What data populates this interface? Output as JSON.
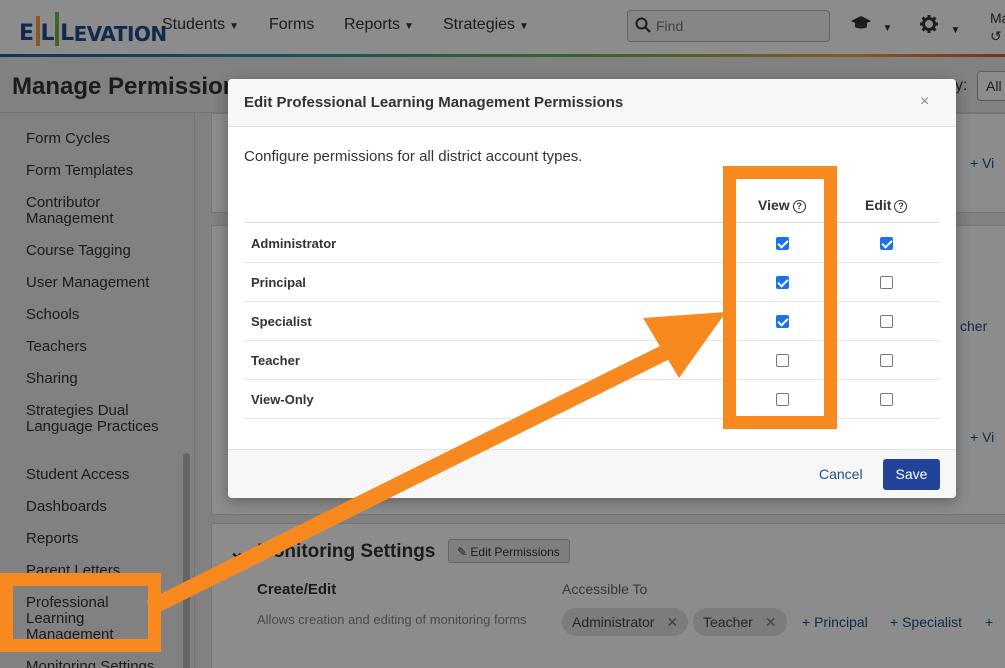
{
  "nav": {
    "logo_parts": [
      "E",
      "L",
      "L",
      "EVATION"
    ],
    "items": [
      {
        "label": "Students"
      },
      {
        "label": "Forms"
      },
      {
        "label": "Reports"
      },
      {
        "label": "Strategies"
      }
    ],
    "search_placeholder": "Find",
    "user_initials": "Ma"
  },
  "page": {
    "title": "Manage Permissions",
    "right_label": "y:",
    "right_select": "All"
  },
  "sidebar": {
    "items": [
      {
        "label": "Form Cycles"
      },
      {
        "label": "Form Templates"
      },
      {
        "label": "Contributor Management"
      },
      {
        "label": "Course Tagging"
      },
      {
        "label": "User Management"
      },
      {
        "label": "Schools"
      },
      {
        "label": "Teachers"
      },
      {
        "label": "Sharing"
      },
      {
        "label": "Strategies Dual Language Practices"
      },
      {
        "label": "Student Access"
      },
      {
        "label": "Dashboards"
      },
      {
        "label": "Reports"
      },
      {
        "label": "Parent Letters"
      },
      {
        "label": "Professional Learning Management"
      },
      {
        "label": "Monitoring Settings"
      }
    ]
  },
  "background": {
    "link_view_1": "+ Vi",
    "link_teacher": "cher",
    "link_view_2": "+ Vi",
    "section_title": "Monitoring Settings",
    "edit_permissions_label": "Edit Permissions",
    "create_edit_label": "Create/Edit",
    "create_edit_desc": "Allows creation and editing of monitoring forms",
    "accessible_label": "Accessible To",
    "chips": [
      "Administrator",
      "Teacher"
    ],
    "add_links": [
      "+ Principal",
      "+ Specialist",
      "+"
    ]
  },
  "modal": {
    "title": "Edit Professional Learning Management Permissions",
    "close_glyph": "×",
    "description": "Configure permissions for all district account types.",
    "columns": {
      "view": "View",
      "edit": "Edit"
    },
    "help_glyph": "?",
    "rows": [
      {
        "label": "Administrator",
        "view": true,
        "edit": true
      },
      {
        "label": "Principal",
        "view": true,
        "edit": false
      },
      {
        "label": "Specialist",
        "view": true,
        "edit": false
      },
      {
        "label": "Teacher",
        "view": false,
        "edit": false
      },
      {
        "label": "View-Only",
        "view": false,
        "edit": false
      }
    ],
    "cancel_label": "Cancel",
    "save_label": "Save"
  },
  "colors": {
    "accent": "#21449a",
    "highlight": "#f7891f",
    "checkbox_on": "#1a73e8"
  }
}
